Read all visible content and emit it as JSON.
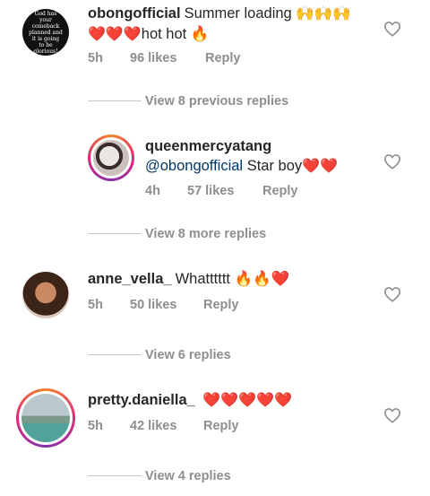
{
  "comments": [
    {
      "username": "obongofficial",
      "text": "Summer loading",
      "text_emojis": "🙌🙌🙌",
      "text_line2_emojis": "❤️❤️❤️",
      "text_line2": "hot hot",
      "text_line2_tail": "🔥",
      "time": "5h",
      "likes": "96 likes",
      "reply": "Reply",
      "avatar_text": "God has your comeback planned and it is going to be glorious!",
      "avatar_icon": "quote-avatar"
    },
    {
      "username": "queenmercyatang",
      "mention": "@obongofficial",
      "text": "Star boy",
      "text_emojis": "❤️❤️",
      "time": "4h",
      "likes": "57 likes",
      "reply": "Reply",
      "avatar_icon": "profile-photo-icon"
    },
    {
      "username": "anne_vella_",
      "text": "Whatttttt",
      "text_emojis": "🔥🔥❤️",
      "time": "5h",
      "likes": "50 likes",
      "reply": "Reply",
      "avatar_icon": "profile-photo-icon"
    },
    {
      "username": "pretty.daniella_",
      "text_emojis": "❤️❤️❤️❤️❤️",
      "time": "5h",
      "likes": "42 likes",
      "reply": "Reply",
      "avatar_icon": "profile-photo-icon"
    }
  ],
  "view_links": {
    "previous": "View 8 previous replies",
    "more": "View 8 more replies",
    "anne": "View 6 replies",
    "daniella": "View 4 replies"
  },
  "icons": {
    "like": "heart-outline-icon"
  },
  "colors": {
    "username": "#262626",
    "mention": "#00376b",
    "meta": "#8e8e8e",
    "heart_red": "#e0162b"
  }
}
